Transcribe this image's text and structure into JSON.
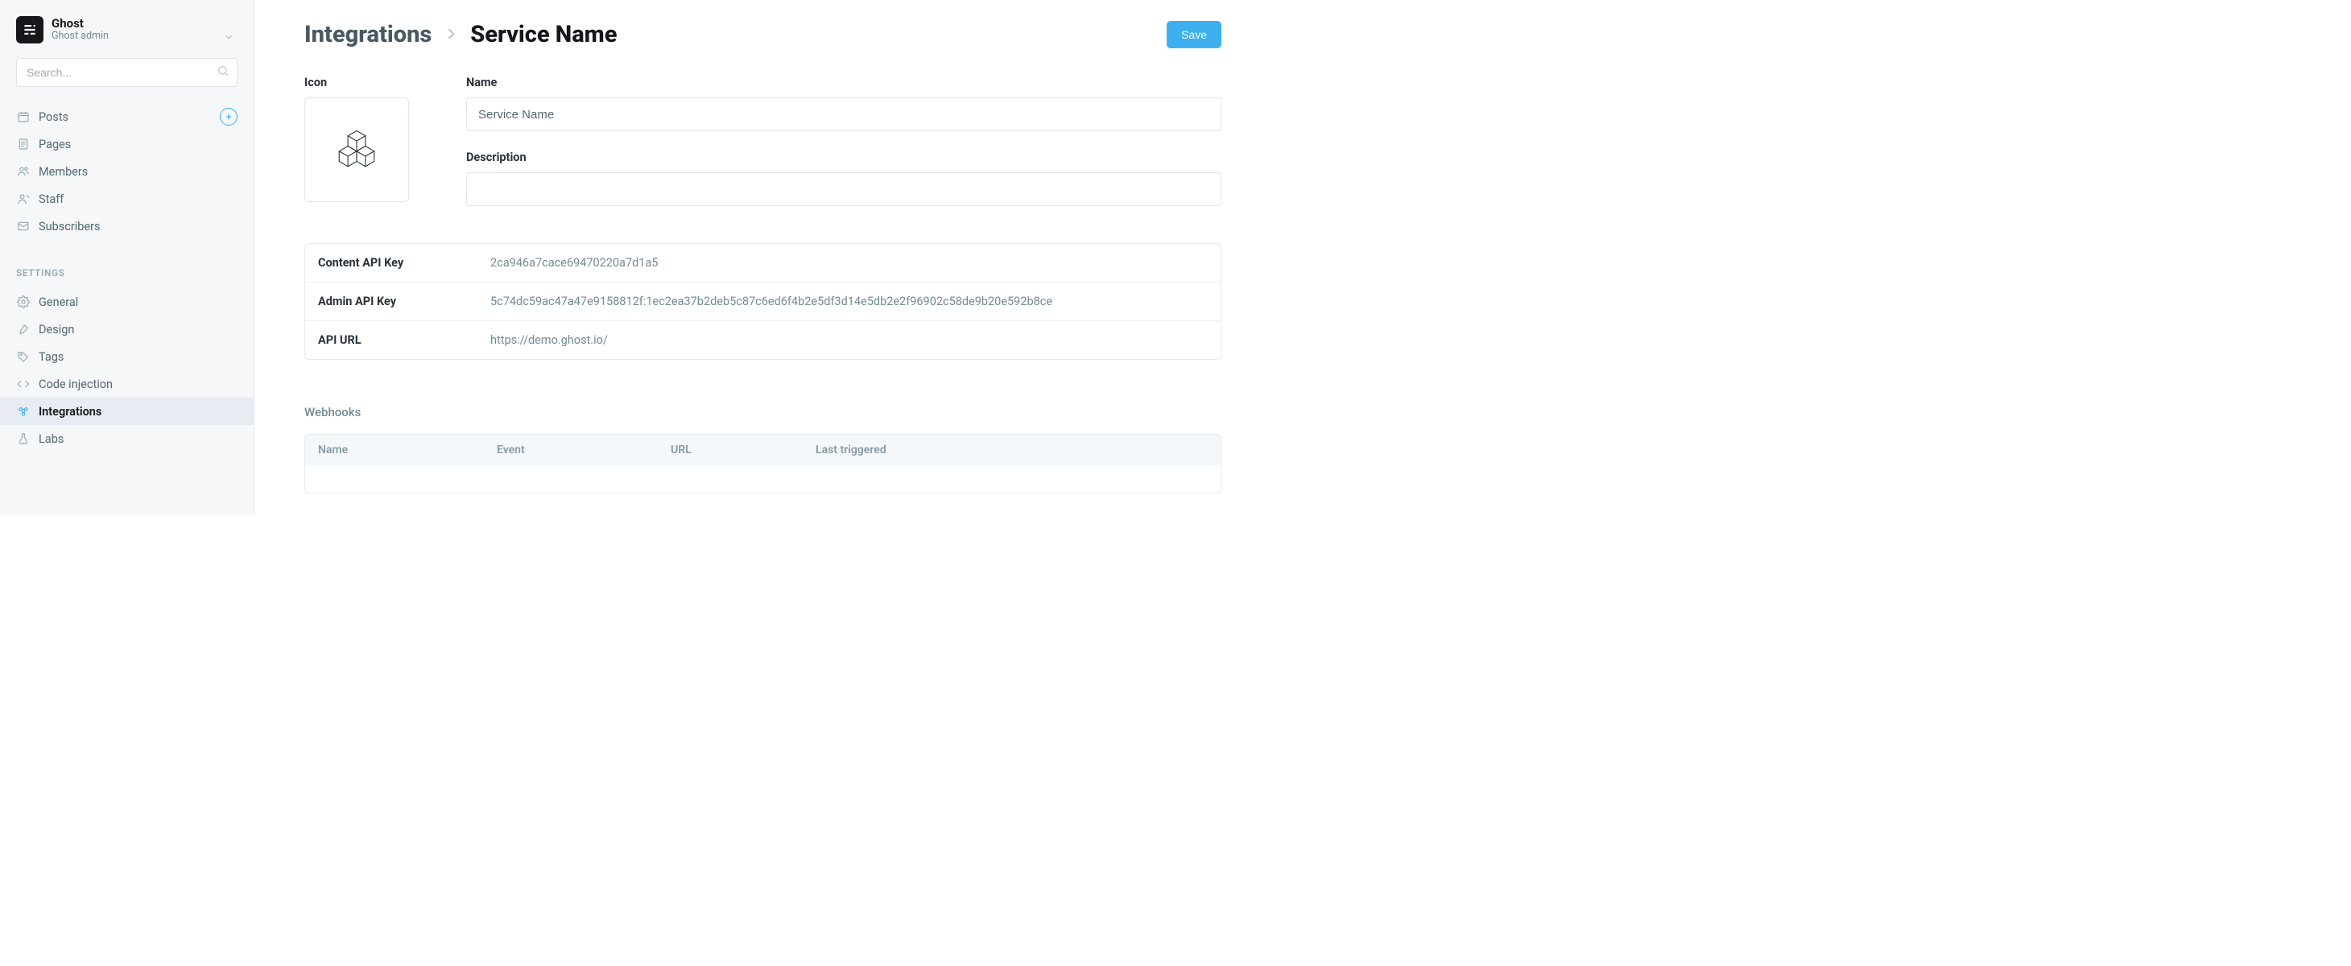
{
  "brand": {
    "title": "Ghost",
    "subtitle": "Ghost admin"
  },
  "search": {
    "placeholder": "Search..."
  },
  "nav": {
    "primary": [
      {
        "label": "Posts"
      },
      {
        "label": "Pages"
      },
      {
        "label": "Members"
      },
      {
        "label": "Staff"
      },
      {
        "label": "Subscribers"
      }
    ],
    "settings_heading": "SETTINGS",
    "settings": [
      {
        "label": "General"
      },
      {
        "label": "Design"
      },
      {
        "label": "Tags"
      },
      {
        "label": "Code injection"
      },
      {
        "label": "Integrations"
      },
      {
        "label": "Labs"
      }
    ]
  },
  "header": {
    "root": "Integrations",
    "current": "Service Name",
    "save_label": "Save"
  },
  "form": {
    "icon_label": "Icon",
    "name_label": "Name",
    "name_value": "Service Name",
    "desc_label": "Description",
    "desc_value": ""
  },
  "api": {
    "rows": [
      {
        "label": "Content API Key",
        "value": "2ca946a7cace69470220a7d1a5"
      },
      {
        "label": "Admin API Key",
        "value": "5c74dc59ac47a47e9158812f:1ec2ea37b2deb5c87c6ed6f4b2e5df3d14e5db2e2f96902c58de9b20e592b8ce"
      },
      {
        "label": "API URL",
        "value": "https://demo.ghost.io/"
      }
    ]
  },
  "webhooks": {
    "heading": "Webhooks",
    "columns": [
      "Name",
      "Event",
      "URL",
      "Last triggered"
    ]
  }
}
